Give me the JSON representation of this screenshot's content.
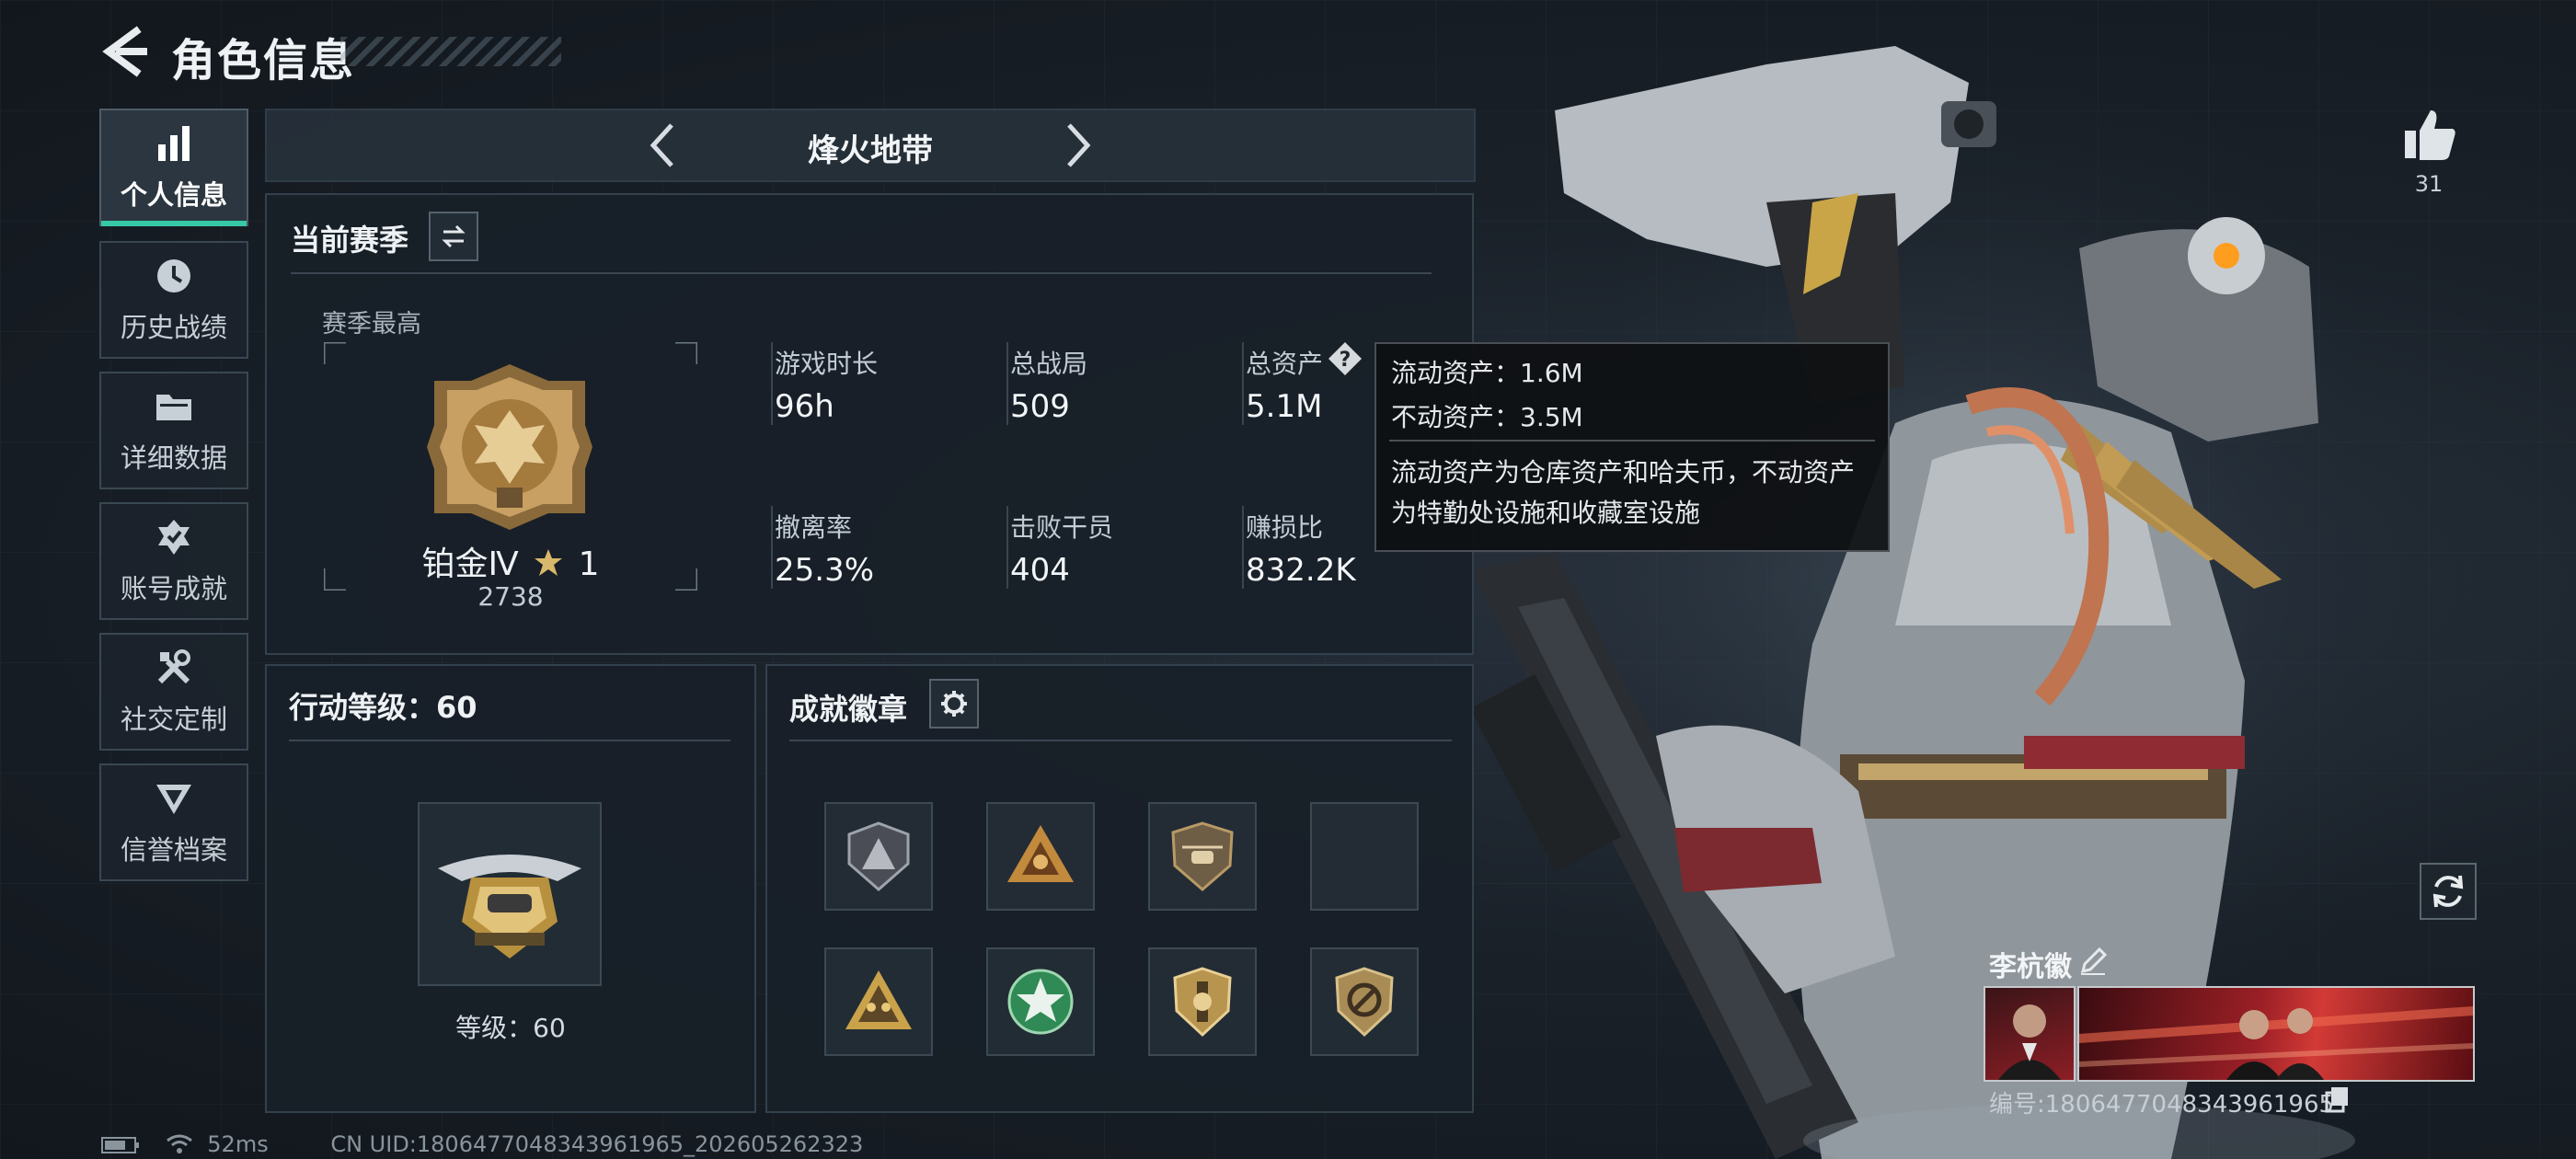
{
  "header": {
    "title": "角色信息"
  },
  "sidebar": {
    "items": [
      {
        "label": "个人信息",
        "icon": "bar-chart-icon",
        "active": true
      },
      {
        "label": "历史战绩",
        "icon": "history-clock-icon",
        "active": false
      },
      {
        "label": "详细数据",
        "icon": "folder-icon",
        "active": false
      },
      {
        "label": "账号成就",
        "icon": "achievement-icon",
        "active": false
      },
      {
        "label": "社交定制",
        "icon": "tools-icon",
        "active": false
      },
      {
        "label": "信誉档案",
        "icon": "credit-icon",
        "active": false
      }
    ]
  },
  "mode": {
    "name": "烽火地带"
  },
  "season": {
    "title": "当前赛季",
    "peak_label": "赛季最高",
    "rank_name": "铂金Ⅳ",
    "rank_stars": "1",
    "rank_score": "2738",
    "stats": [
      {
        "label": "游戏时长",
        "value": "96h"
      },
      {
        "label": "总战局",
        "value": "509"
      },
      {
        "label": "总资产",
        "value": "5.1M"
      },
      {
        "label": "撤离率",
        "value": "25.3%"
      },
      {
        "label": "击败干员",
        "value": "404"
      },
      {
        "label": "赚损比",
        "value": "832.2K"
      }
    ]
  },
  "tooltip": {
    "liquid": "流动资产：1.6M",
    "fixed": "不动资产：3.5M",
    "desc_line1": "流动资产为仓库资产和哈夫币，不动资产",
    "desc_line2": "为特勤处设施和收藏室设施"
  },
  "level": {
    "title": "行动等级：60",
    "label": "等级：60"
  },
  "badges": {
    "title": "成就徽章",
    "items": [
      {
        "icon": "triangle-badge-icon",
        "color": "#7b7d86"
      },
      {
        "icon": "triangle-hands-badge-icon",
        "color": "#c28a3c"
      },
      {
        "icon": "helicopter-shield-badge-icon",
        "color": "#b89a66"
      },
      {
        "icon": "empty-slot-icon",
        "color": "#2b343c"
      },
      {
        "icon": "triangle-figures-badge-icon",
        "color": "#c9a24a"
      },
      {
        "icon": "green-star-badge-icon",
        "color": "#2f8a55"
      },
      {
        "icon": "gold-shield-badge-icon",
        "color": "#b8954e"
      },
      {
        "icon": "no-sign-shield-badge-icon",
        "color": "#a98c55"
      }
    ]
  },
  "likes": {
    "count": "31"
  },
  "player": {
    "name": "李杭徽",
    "id_text": "编号:1806477048343961965"
  },
  "status": {
    "ping": "52ms",
    "uid": "CN UID:1806477048343961965_202605262323"
  },
  "colors": {
    "accent": "#37c8a8",
    "tooltip_bg": "#0e1012"
  }
}
